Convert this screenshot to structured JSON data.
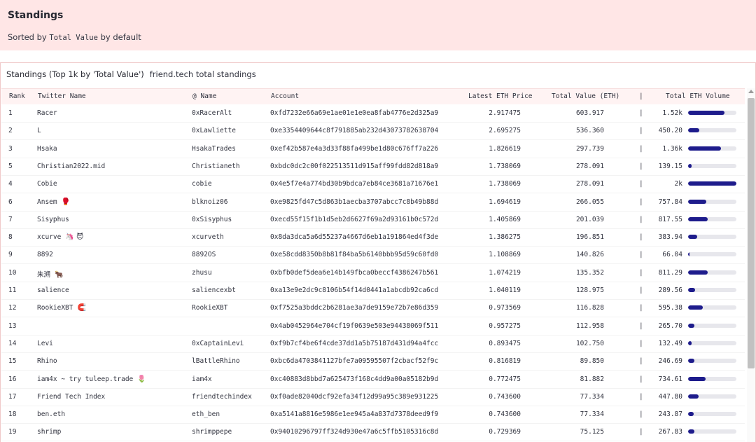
{
  "header": {
    "title": "Standings",
    "subtitle_before": "Sorted by ",
    "subtitle_mono": "Total Value",
    "subtitle_after": " by default"
  },
  "panel": {
    "caption": "Standings (Top 1k by 'Total Value')",
    "caption_sub": "friend.tech total standings"
  },
  "columns": {
    "rank": "Rank",
    "twitter": "Twitter Name",
    "at_name": "@ Name",
    "account": "Account",
    "eth_price": "Latest ETH Price",
    "total_value": "Total Value (ETH)",
    "sep": "|",
    "volume": "Total ETH Volume"
  },
  "volume_max": 2000,
  "bar_color": "#1e1c8c",
  "rows": [
    {
      "rank": "1",
      "twitter": "Racer",
      "emoji": "",
      "at": "0xRacerAlt",
      "account": "0xfd7232e66a69e1ae01e1e0ea8fab4776e2d325a9",
      "price": "2.917475",
      "value": "603.917",
      "sep": "|",
      "volume_label": "1.52k",
      "volume": 1520
    },
    {
      "rank": "2",
      "twitter": "L",
      "emoji": "",
      "at": "0xLawliette",
      "account": "0xe3354409644c8f791885ab232d43073782638704",
      "price": "2.695275",
      "value": "536.360",
      "sep": "|",
      "volume_label": "450.20",
      "volume": 450.2
    },
    {
      "rank": "3",
      "twitter": "Hsaka",
      "emoji": "",
      "at": "HsakaTrades",
      "account": "0xef42b587e4a3d33f88fa499be1d80c676ff7a226",
      "price": "1.826619",
      "value": "297.739",
      "sep": "|",
      "volume_label": "1.36k",
      "volume": 1360
    },
    {
      "rank": "5",
      "twitter": "Christian2022.mid",
      "emoji": "",
      "at": "Christianeth",
      "account": "0xbdc0dc2c00f022513511d915aff99fdd82d818a9",
      "price": "1.738069",
      "value": "278.091",
      "sep": "|",
      "volume_label": "139.15",
      "volume": 139.15
    },
    {
      "rank": "4",
      "twitter": "Cobie",
      "emoji": "",
      "at": "cobie",
      "account": "0x4e5f7e4a774bd30b9bdca7eb84ce3681a71676e1",
      "price": "1.738069",
      "value": "278.091",
      "sep": "|",
      "volume_label": "2k",
      "volume": 2000
    },
    {
      "rank": "6",
      "twitter": "Ansem",
      "emoji": "🥊",
      "at": "blknoiz06",
      "account": "0xe9825fd47c5d863b1aecba3707abcc7c8b49b88d",
      "price": "1.694619",
      "value": "266.055",
      "sep": "|",
      "volume_label": "757.84",
      "volume": 757.84
    },
    {
      "rank": "7",
      "twitter": "Sisyphus",
      "emoji": "",
      "at": "0xSisyphus",
      "account": "0xecd55f15f1b1d5eb2d6627f69a2d93161b0c572d",
      "price": "1.405869",
      "value": "201.039",
      "sep": "|",
      "volume_label": "817.55",
      "volume": 817.55
    },
    {
      "rank": "8",
      "twitter": "xcurve",
      "emoji": "🦄 😈",
      "at": "xcurveth",
      "account": "0x8da3dca5a6d55237a4667d6eb1a191864ed4f3de",
      "price": "1.386275",
      "value": "196.851",
      "sep": "|",
      "volume_label": "383.94",
      "volume": 383.94
    },
    {
      "rank": "9",
      "twitter": "8892",
      "emoji": "",
      "at": "8892OS",
      "account": "0xe58cdd8350b8b81f84ba5b6140bbb95d59c60fd0",
      "price": "1.108869",
      "value": "140.826",
      "sep": "|",
      "volume_label": "66.04",
      "volume": 66.04
    },
    {
      "rank": "10",
      "twitter": "朱溯",
      "emoji": "🐂",
      "at": "zhusu",
      "account": "0xbfb0def5dea6e14b149fbca0beccf4386247b561",
      "price": "1.074219",
      "value": "135.352",
      "sep": "|",
      "volume_label": "811.29",
      "volume": 811.29
    },
    {
      "rank": "11",
      "twitter": "salience",
      "emoji": "",
      "at": "saliencexbt",
      "account": "0xa13e9e2dc9c8106b54f14d0441a1abcdb92ca6cd",
      "price": "1.040119",
      "value": "128.975",
      "sep": "|",
      "volume_label": "289.56",
      "volume": 289.56
    },
    {
      "rank": "12",
      "twitter": "RookieXBT",
      "emoji": "🧲",
      "at": "RookieXBT",
      "account": "0xf7525a3bddc2b6281ae3a7de9159e72b7e86d359",
      "price": "0.973569",
      "value": "116.828",
      "sep": "|",
      "volume_label": "595.38",
      "volume": 595.38
    },
    {
      "rank": "13",
      "twitter": "",
      "emoji": "",
      "at": "",
      "account": "0x4ab0452964e704cf19f0639e503e94438069f511",
      "price": "0.957275",
      "value": "112.958",
      "sep": "|",
      "volume_label": "265.70",
      "volume": 265.7
    },
    {
      "rank": "14",
      "twitter": "Levi",
      "emoji": "",
      "at": "0xCaptainLevi",
      "account": "0xf9b7cf4be6f4cde37dd1a5b75187d431d94a4fcc",
      "price": "0.893475",
      "value": "102.750",
      "sep": "|",
      "volume_label": "132.49",
      "volume": 132.49
    },
    {
      "rank": "15",
      "twitter": "Rhino",
      "emoji": "",
      "at": "lBattleRhino",
      "account": "0xbc6da4703841127bfe7a09595507f2cbacf52f9c",
      "price": "0.816819",
      "value": "89.850",
      "sep": "|",
      "volume_label": "246.69",
      "volume": 246.69
    },
    {
      "rank": "16",
      "twitter": "iam4x ~ try tuleep.trade",
      "emoji": "🌷",
      "bold_part": "iam4x",
      "at": "iam4x",
      "account": "0xc40883d8bbd7a625473f168c4dd9a00a05182b9d",
      "price": "0.772475",
      "value": "81.882",
      "sep": "|",
      "volume_label": "734.61",
      "volume": 734.61
    },
    {
      "rank": "17",
      "twitter": "Friend Tech Index",
      "emoji": "",
      "at": "friendtechindex",
      "account": "0xf0ade82040dcf92efa34f12d99a95c389e931225",
      "price": "0.743600",
      "value": "77.334",
      "sep": "|",
      "volume_label": "447.80",
      "volume": 447.8
    },
    {
      "rank": "18",
      "twitter": "ben.eth",
      "emoji": "",
      "at": "eth_ben",
      "account": "0xa5141a8816e5986e1ee945a4a837d7378deed9f9",
      "price": "0.743600",
      "value": "77.334",
      "sep": "|",
      "volume_label": "243.87",
      "volume": 243.87
    },
    {
      "rank": "19",
      "twitter": "shrimp",
      "emoji": "",
      "at": "shrimppepe",
      "account": "0x94010296797ff324d930e47a6c5ffb5105316c8d",
      "price": "0.729369",
      "value": "75.125",
      "sep": "|",
      "volume_label": "267.83",
      "volume": 267.83
    }
  ]
}
